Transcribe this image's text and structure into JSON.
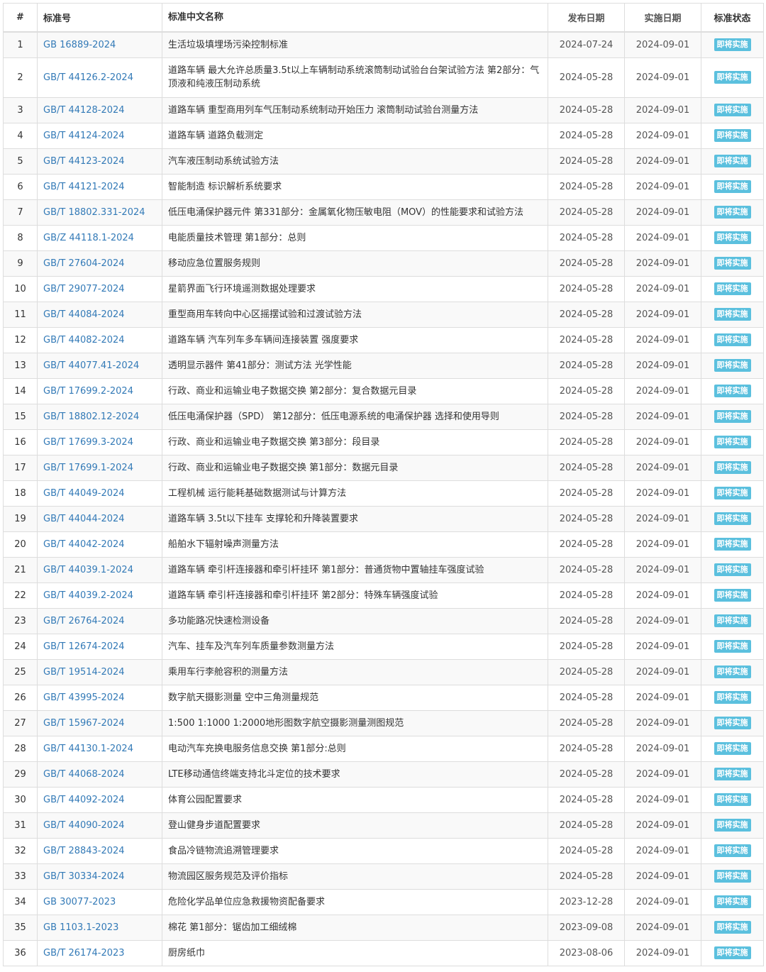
{
  "headers": {
    "num": "#",
    "code": "标准号",
    "name": "标准中文名称",
    "publish": "发布日期",
    "implement": "实施日期",
    "status": "标准状态"
  },
  "colors": {
    "link": "#337ab7",
    "badge": "#5bc0de",
    "border": "#dddddd",
    "stripe": "#f9f9f9"
  },
  "rows": [
    {
      "num": "1",
      "code": "GB 16889-2024",
      "name": "生活垃圾填埋场污染控制标准",
      "publish": "2024-07-24",
      "implement": "2024-09-01",
      "status": "即将实施"
    },
    {
      "num": "2",
      "code": "GB/T 44126.2-2024",
      "name": "道路车辆 最大允许总质量3.5t以上车辆制动系统滚筒制动试验台台架试验方法 第2部分：气顶液和纯液压制动系统",
      "publish": "2024-05-28",
      "implement": "2024-09-01",
      "status": "即将实施"
    },
    {
      "num": "3",
      "code": "GB/T 44128-2024",
      "name": "道路车辆 重型商用列车气压制动系统制动开始压力 滚筒制动试验台测量方法",
      "publish": "2024-05-28",
      "implement": "2024-09-01",
      "status": "即将实施"
    },
    {
      "num": "4",
      "code": "GB/T 44124-2024",
      "name": "道路车辆 道路负载测定",
      "publish": "2024-05-28",
      "implement": "2024-09-01",
      "status": "即将实施"
    },
    {
      "num": "5",
      "code": "GB/T 44123-2024",
      "name": "汽车液压制动系统试验方法",
      "publish": "2024-05-28",
      "implement": "2024-09-01",
      "status": "即将实施"
    },
    {
      "num": "6",
      "code": "GB/T 44121-2024",
      "name": "智能制造 标识解析系统要求",
      "publish": "2024-05-28",
      "implement": "2024-09-01",
      "status": "即将实施"
    },
    {
      "num": "7",
      "code": "GB/T 18802.331-2024",
      "name": "低压电涌保护器元件 第331部分：金属氧化物压敏电阻（MOV）的性能要求和试验方法",
      "publish": "2024-05-28",
      "implement": "2024-09-01",
      "status": "即将实施"
    },
    {
      "num": "8",
      "code": "GB/Z 44118.1-2024",
      "name": "电能质量技术管理 第1部分：总则",
      "publish": "2024-05-28",
      "implement": "2024-09-01",
      "status": "即将实施"
    },
    {
      "num": "9",
      "code": "GB/T 27604-2024",
      "name": "移动应急位置服务规则",
      "publish": "2024-05-28",
      "implement": "2024-09-01",
      "status": "即将实施"
    },
    {
      "num": "10",
      "code": "GB/T 29077-2024",
      "name": "星箭界面飞行环境遥测数据处理要求",
      "publish": "2024-05-28",
      "implement": "2024-09-01",
      "status": "即将实施"
    },
    {
      "num": "11",
      "code": "GB/T 44084-2024",
      "name": "重型商用车转向中心区摇摆试验和过渡试验方法",
      "publish": "2024-05-28",
      "implement": "2024-09-01",
      "status": "即将实施"
    },
    {
      "num": "12",
      "code": "GB/T 44082-2024",
      "name": "道路车辆 汽车列车多车辆间连接装置 强度要求",
      "publish": "2024-05-28",
      "implement": "2024-09-01",
      "status": "即将实施"
    },
    {
      "num": "13",
      "code": "GB/T 44077.41-2024",
      "name": "透明显示器件 第41部分：测试方法 光学性能",
      "publish": "2024-05-28",
      "implement": "2024-09-01",
      "status": "即将实施"
    },
    {
      "num": "14",
      "code": "GB/T 17699.2-2024",
      "name": "行政、商业和运输业电子数据交换 第2部分：复合数据元目录",
      "publish": "2024-05-28",
      "implement": "2024-09-01",
      "status": "即将实施"
    },
    {
      "num": "15",
      "code": "GB/T 18802.12-2024",
      "name": "低压电涌保护器（SPD） 第12部分：低压电源系统的电涌保护器 选择和使用导则",
      "publish": "2024-05-28",
      "implement": "2024-09-01",
      "status": "即将实施"
    },
    {
      "num": "16",
      "code": "GB/T 17699.3-2024",
      "name": "行政、商业和运输业电子数据交换 第3部分：段目录",
      "publish": "2024-05-28",
      "implement": "2024-09-01",
      "status": "即将实施"
    },
    {
      "num": "17",
      "code": "GB/T 17699.1-2024",
      "name": "行政、商业和运输业电子数据交换 第1部分：数据元目录",
      "publish": "2024-05-28",
      "implement": "2024-09-01",
      "status": "即将实施"
    },
    {
      "num": "18",
      "code": "GB/T 44049-2024",
      "name": "工程机械 运行能耗基础数据测试与计算方法",
      "publish": "2024-05-28",
      "implement": "2024-09-01",
      "status": "即将实施"
    },
    {
      "num": "19",
      "code": "GB/T 44044-2024",
      "name": "道路车辆 3.5t以下挂车 支撑轮和升降装置要求",
      "publish": "2024-05-28",
      "implement": "2024-09-01",
      "status": "即将实施"
    },
    {
      "num": "20",
      "code": "GB/T 44042-2024",
      "name": "船舶水下辐射噪声测量方法",
      "publish": "2024-05-28",
      "implement": "2024-09-01",
      "status": "即将实施"
    },
    {
      "num": "21",
      "code": "GB/T 44039.1-2024",
      "name": "道路车辆 牵引杆连接器和牵引杆挂环 第1部分：普通货物中置轴挂车强度试验",
      "publish": "2024-05-28",
      "implement": "2024-09-01",
      "status": "即将实施"
    },
    {
      "num": "22",
      "code": "GB/T 44039.2-2024",
      "name": "道路车辆 牵引杆连接器和牵引杆挂环 第2部分：特殊车辆强度试验",
      "publish": "2024-05-28",
      "implement": "2024-09-01",
      "status": "即将实施"
    },
    {
      "num": "23",
      "code": "GB/T 26764-2024",
      "name": "多功能路况快速检测设备",
      "publish": "2024-05-28",
      "implement": "2024-09-01",
      "status": "即将实施"
    },
    {
      "num": "24",
      "code": "GB/T 12674-2024",
      "name": "汽车、挂车及汽车列车质量参数测量方法",
      "publish": "2024-05-28",
      "implement": "2024-09-01",
      "status": "即将实施"
    },
    {
      "num": "25",
      "code": "GB/T 19514-2024",
      "name": "乘用车行李舱容积的测量方法",
      "publish": "2024-05-28",
      "implement": "2024-09-01",
      "status": "即将实施"
    },
    {
      "num": "26",
      "code": "GB/T 43995-2024",
      "name": "数字航天摄影测量 空中三角测量规范",
      "publish": "2024-05-28",
      "implement": "2024-09-01",
      "status": "即将实施"
    },
    {
      "num": "27",
      "code": "GB/T 15967-2024",
      "name": "1:500 1:1000 1:2000地形图数字航空摄影测量测图规范",
      "publish": "2024-05-28",
      "implement": "2024-09-01",
      "status": "即将实施"
    },
    {
      "num": "28",
      "code": "GB/T 44130.1-2024",
      "name": "电动汽车充换电服务信息交换 第1部分:总则",
      "publish": "2024-05-28",
      "implement": "2024-09-01",
      "status": "即将实施"
    },
    {
      "num": "29",
      "code": "GB/T 44068-2024",
      "name": "LTE移动通信终端支持北斗定位的技术要求",
      "publish": "2024-05-28",
      "implement": "2024-09-01",
      "status": "即将实施"
    },
    {
      "num": "30",
      "code": "GB/T 44092-2024",
      "name": "体育公园配置要求",
      "publish": "2024-05-28",
      "implement": "2024-09-01",
      "status": "即将实施"
    },
    {
      "num": "31",
      "code": "GB/T 44090-2024",
      "name": "登山健身步道配置要求",
      "publish": "2024-05-28",
      "implement": "2024-09-01",
      "status": "即将实施"
    },
    {
      "num": "32",
      "code": "GB/T 28843-2024",
      "name": "食品冷链物流追溯管理要求",
      "publish": "2024-05-28",
      "implement": "2024-09-01",
      "status": "即将实施"
    },
    {
      "num": "33",
      "code": "GB/T 30334-2024",
      "name": "物流园区服务规范及评价指标",
      "publish": "2024-05-28",
      "implement": "2024-09-01",
      "status": "即将实施"
    },
    {
      "num": "34",
      "code": "GB 30077-2023",
      "name": "危险化学品单位应急救援物资配备要求",
      "publish": "2023-12-28",
      "implement": "2024-09-01",
      "status": "即将实施"
    },
    {
      "num": "35",
      "code": "GB 1103.1-2023",
      "name": "棉花 第1部分：锯齿加工细绒棉",
      "publish": "2023-09-08",
      "implement": "2024-09-01",
      "status": "即将实施"
    },
    {
      "num": "36",
      "code": "GB/T 26174-2023",
      "name": "厨房纸巾",
      "publish": "2023-08-06",
      "implement": "2024-09-01",
      "status": "即将实施"
    }
  ]
}
